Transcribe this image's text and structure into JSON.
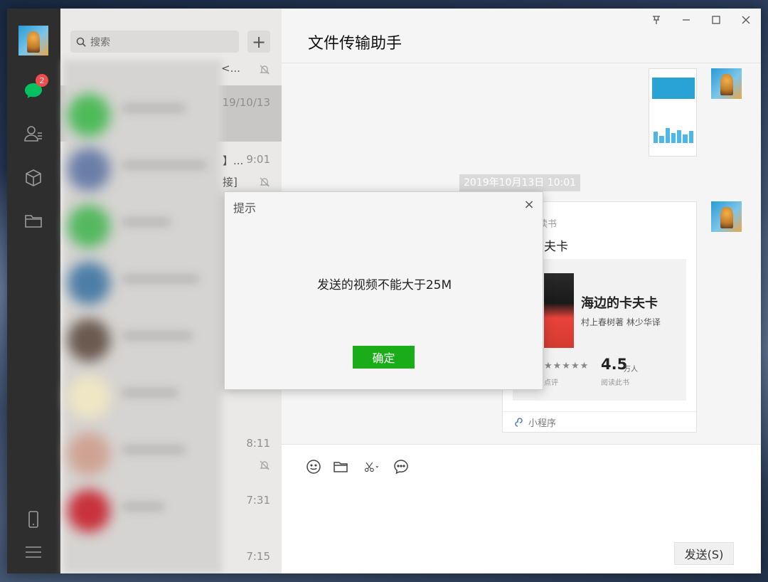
{
  "sidebar": {
    "unread_badge": "2",
    "icons": [
      "chat-icon",
      "contacts-icon",
      "favorites-icon",
      "files-icon",
      "phone-icon",
      "menu-icon"
    ]
  },
  "chat_list": {
    "search_placeholder": "搜索",
    "add_label": "+",
    "rows": [
      {
        "snippet": "<...",
        "time": ""
      },
      {
        "snippet": "",
        "time": "19/10/13"
      },
      {
        "snippet": "】...",
        "time": "9:01"
      },
      {
        "snippet": "接]",
        "time": ""
      },
      {
        "snippet": "",
        "time": "8:11"
      },
      {
        "snippet": "",
        "time": "7:31"
      },
      {
        "snippet": "",
        "time": "7:15"
      }
    ]
  },
  "chat": {
    "title": "文件传输助手",
    "timestamp": "2019年10月13日 10:01",
    "card": {
      "source": "微信读书",
      "title": "的卡夫卡",
      "book_title": "海边的卡夫卡",
      "book_author": "村上春树著 林少华译",
      "stars": "★★★★★",
      "stars_label": "点评",
      "rating": "4.5",
      "rating_unit": "万人",
      "readers_label": "阅读此书",
      "footer": "小程序"
    },
    "send_label": "发送(S)"
  },
  "dialog": {
    "title": "提示",
    "close": "×",
    "message": "发送的视频不能大于25M",
    "ok_label": "确定"
  },
  "colors": {
    "accent_green": "#1aad19",
    "badge_red": "#f04c4c",
    "sidebar_bg": "#2e2e2e"
  }
}
